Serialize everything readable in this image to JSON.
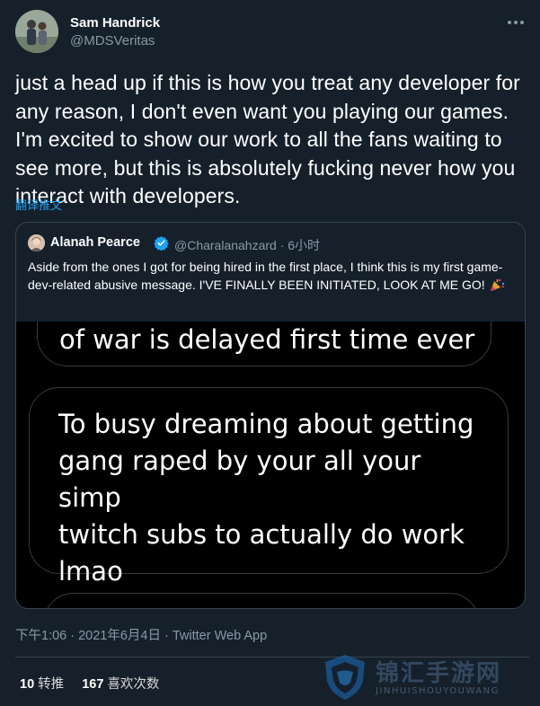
{
  "author": {
    "display_name": "Sam Handrick",
    "handle": "@MDSVeritas"
  },
  "tweet": {
    "text": "just a head up if this is how you treat any developer for any reason, I don't even want you playing our games. I'm excited to show our work to all the fans waiting to see more, but this is absolutely fucking never how you interact with developers.",
    "translate_label": "翻译推文"
  },
  "quote": {
    "display_name": "Alanah Pearce",
    "handle_time": "@Charalanahzard · 6小时",
    "text": "Aside from the ones I got for being hired in the first place, I think this is my first game-dev-related abusive message. I'VE FINALLY BEEN INITIATED, LOOK AT ME GO!",
    "media": {
      "bubble_1_text": "of war is delayed first time ever",
      "bubble_2_lines": [
        "To busy dreaming about getting",
        "gang raped by your all your simp",
        "twitch subs to actually do work",
        "lmao"
      ]
    }
  },
  "meta": {
    "timestamp": "下午1:06 · 2021年6月4日 · Twitter Web App"
  },
  "stats": {
    "retweets_count": "10",
    "retweets_label": "转推",
    "likes_count": "167",
    "likes_label": "喜欢次数"
  },
  "watermark": {
    "title": "锦汇手游网",
    "subtitle": "JINHUISHOUYOUWANG"
  },
  "icons": {
    "more": "more-horizontal-icon",
    "verified": "verified-badge-icon",
    "party": "party-popper-icon",
    "shield": "shield-logo-icon"
  },
  "colors": {
    "background": "#15202b",
    "accent": "#1da1f2",
    "muted": "#8899a6",
    "border": "#38444d"
  }
}
